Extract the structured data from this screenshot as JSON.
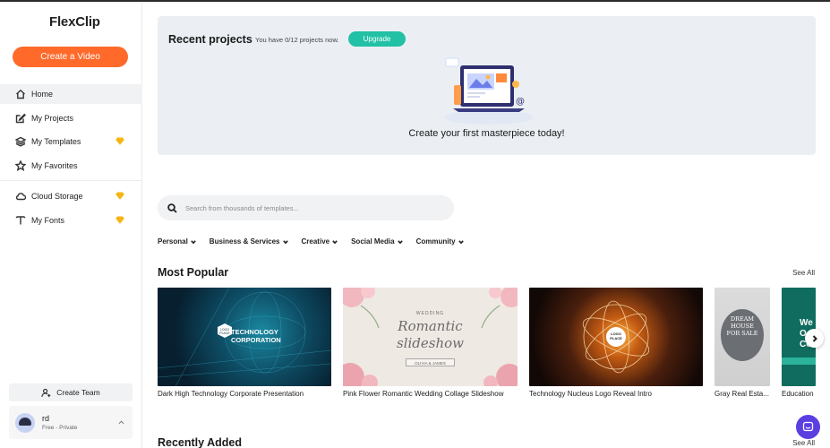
{
  "sidebar": {
    "logo_text": "FlexClip",
    "create_label": "Create a Video",
    "items": [
      {
        "label": "Home",
        "icon": "home-icon",
        "active": true,
        "premium": false
      },
      {
        "label": "My Projects",
        "icon": "edit-icon",
        "active": false,
        "premium": false
      },
      {
        "label": "My Templates",
        "icon": "layers-icon",
        "active": false,
        "premium": true
      },
      {
        "label": "My Favorites",
        "icon": "star-icon",
        "active": false,
        "premium": false
      }
    ],
    "items_secondary": [
      {
        "label": "Cloud Storage",
        "icon": "cloud-icon",
        "premium": true
      },
      {
        "label": "My Fonts",
        "icon": "text-icon",
        "premium": true
      }
    ],
    "team_label": "Create Team",
    "user": {
      "name": "rd",
      "plan": "Free - Private"
    }
  },
  "recent": {
    "title": "Recent projects",
    "count_text": "You have 0/12 projects now.",
    "upgrade_label": "Upgrade",
    "empty_text": "Create your first masterpiece today!"
  },
  "search": {
    "placeholder": "Search from thousands of templates..."
  },
  "categories": [
    "Personal",
    "Business & Services",
    "Creative",
    "Social Media",
    "Community"
  ],
  "most_popular": {
    "title": "Most Popular",
    "see_all": "See All",
    "items": [
      {
        "caption": "Dark High Technology Corporate Presentation",
        "overlay": "TECHNOLOGY CORPORATION",
        "logo": "LOGO PLACE"
      },
      {
        "caption": "Pink Flower Romantic Wedding Collage Slideshow",
        "overlay_small": "WEDDING",
        "overlay_line1": "Romantic",
        "overlay_line2": "slideshow",
        "overlay_names": "OLIVIA & JAMES"
      },
      {
        "caption": "Technology Nucleus Logo Reveal Intro",
        "logo": "LOGO PLACE"
      },
      {
        "caption": "Gray Real Esta...",
        "overlay": "DREAM HOUSE FOR SALE"
      },
      {
        "caption": "Education",
        "overlay": "We O Co"
      }
    ]
  },
  "recently_added": {
    "title": "Recently Added",
    "see_all": "See All"
  },
  "colors": {
    "accent": "#ff6a2b",
    "upgrade": "#22c1a6",
    "premium": "#f6b514",
    "chat": "#5b3fe0",
    "card_bg": "#ebeff4"
  }
}
